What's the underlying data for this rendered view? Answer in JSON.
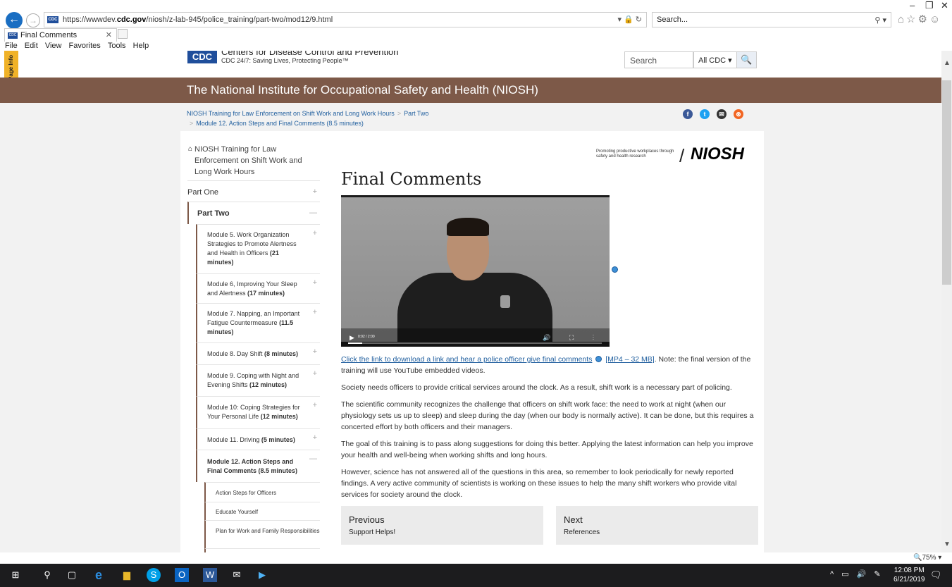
{
  "browser": {
    "url_prefix": "https://wwwdev.",
    "url_domain": "cdc.gov",
    "url_suffix": "/niosh/z-lab-945/police_training/part-two/mod12/9.html",
    "url_icons": "▾ 🔒 ↻",
    "search_placeholder": "Search...",
    "search_icon": "⚲ ▾",
    "toolbar_icons": "⌂☆⚙☺",
    "tab_title": "Final Comments",
    "tab_favicon": "CDC",
    "window_controls": [
      "–",
      "❐",
      "✕"
    ],
    "menu": [
      "File",
      "Edit",
      "View",
      "Favorites",
      "Tools",
      "Help"
    ]
  },
  "page_info_tab": "Page Info",
  "header": {
    "logo": "CDC",
    "org_name": "Centers for Disease Control and Prevention",
    "tagline": "CDC 24/7: Saving Lives, Protecting People™",
    "search_placeholder": "Search",
    "search_scope": "All CDC ▾",
    "search_button": "🔍"
  },
  "niosh_bar_title": "The National Institute for Occupational Safety and Health (NIOSH)",
  "breadcrumb": {
    "item1": "NIOSH Training for Law Enforcement on Shift Work and Long Work Hours",
    "item2": "Part Two",
    "item3": "Module 12. Action Steps and Final Comments (8.5 minutes)",
    "sep": ">"
  },
  "social": [
    "f",
    "t",
    "✉",
    "⊛"
  ],
  "colors": {
    "facebook": "#3b5998",
    "twitter": "#1da1f2",
    "email": "#333333",
    "syndicate": "#f26522",
    "accent": "#7d5948",
    "link": "#1f5e9e"
  },
  "sidebar": {
    "home": "NIOSH Training for Law Enforcement on Shift Work and Long Work Hours",
    "part_one": "Part One",
    "part_two": "Part Two",
    "plus": "+",
    "minus": "—",
    "modules": [
      {
        "text": "Module 5. Work Organization Strategies to Promote Alertness and Health in Officers ",
        "bold": "(21 minutes)"
      },
      {
        "text": "Module 6, Improving Your Sleep and Alertness ",
        "bold": "(17 minutes)"
      },
      {
        "text": "Module 7. Napping, an Important Fatigue Countermeasure ",
        "bold": "(11.5 minutes)"
      },
      {
        "text": "Module 8. Day Shift ",
        "bold": "(8 minutes)"
      },
      {
        "text": "Module 9. Coping with Night and Evening Shifts ",
        "bold": "(12 minutes)"
      },
      {
        "text": "Module 10: Coping Strategies for Your Personal Life ",
        "bold": "(12 minutes)"
      },
      {
        "text": "Module 11. Driving ",
        "bold": "(5 minutes)"
      },
      {
        "text": "",
        "bold": "Module 12. Action Steps and Final Comments (8.5 minutes)"
      }
    ],
    "sub_items": [
      "Action Steps for Officers",
      "Educate Yourself",
      "Plan for Work and Family Responsibilities"
    ]
  },
  "niosh_logo": {
    "tagline": "Promoting productive workplaces through safety and health research",
    "word": "NIOSH"
  },
  "main": {
    "title": "Final Comments",
    "video_time": "0:02 / 2:00",
    "video_controls": "🔊 ⛶ ⋮",
    "download_link": "Click the link to download a link and hear a police officer give final comments",
    "download_size": "[MP4 – 32 MB]",
    "download_note": ". Note: the final version of the training will use YouTube embedded videos.",
    "paragraphs": [
      "Society needs officers to provide critical services around the clock. As a result, shift work is a necessary part of policing.",
      "The scientific community recognizes the challenge that officers on shift work face: the need to work at night (when our physiology sets us up to sleep) and sleep during the day (when our body is normally active). It can be done, but this requires a concerted effort by both officers and their managers.",
      "The goal of this training is to pass along suggestions for doing this better. Applying the latest information can help you improve your health and well-being when working shifts and long hours.",
      "However, science has not answered all of the questions in this area, so remember to look periodically for newly reported findings. A very active community of scientists is working on these issues to help the many shift workers who provide vital services for society around the clock."
    ],
    "prev_label": "Previous",
    "prev_title": "Support Helps!",
    "next_label": "Next",
    "next_title": "References"
  },
  "status": {
    "zoom": "🔍75% ▾"
  },
  "taskbar": {
    "icons": [
      "⊞",
      "⚲",
      "▢",
      "e",
      "▆",
      "S",
      "O",
      "W",
      "✉",
      "▶"
    ],
    "tray": "^ ▭ 🔊 ✎",
    "time": "12:08 PM",
    "date": "6/21/2019",
    "notif": "🗨"
  }
}
